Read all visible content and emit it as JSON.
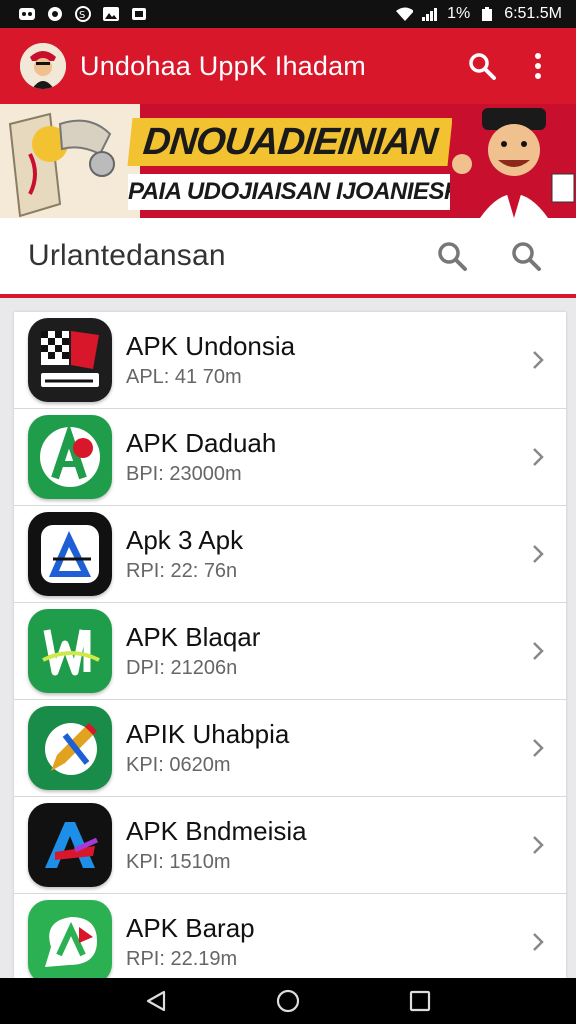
{
  "status_bar": {
    "battery": "1%",
    "time": "6:51.5M"
  },
  "app_bar": {
    "title": "Undohaa UppK Ihadam"
  },
  "banner": {
    "headline": "DNOUADIEINIAN",
    "subline": "PAIA UDOJIAISAN IJOANIESR"
  },
  "search": {
    "label": "Urlantedansan"
  },
  "apps": [
    {
      "name": "APK Undonsia",
      "meta": "APL: 41 70m",
      "icon": "checkered-flag-icon",
      "color": "#1d1d1d"
    },
    {
      "name": "APK Daduah",
      "meta": "BPI: 23000m",
      "icon": "letter-a-icon",
      "color": "#1f9d4a"
    },
    {
      "name": "Apk 3 Apk",
      "meta": "RPI: 22: 76n",
      "icon": "letter-a-outline-icon",
      "color": "#111111"
    },
    {
      "name": "APK Blaqar",
      "meta": "DPI: 21206n",
      "icon": "letter-w-icon",
      "color": "#1f9d4a"
    },
    {
      "name": "APIK Uhabpia",
      "meta": "KPI: 0620m",
      "icon": "pencil-icon",
      "color": "#1a8c4a"
    },
    {
      "name": "APK Bndmeisia",
      "meta": "KPI: 1510m",
      "icon": "letter-a-gradient-icon",
      "color": "#111111"
    },
    {
      "name": "APK Barap",
      "meta": "RPI: 22.19m",
      "icon": "chat-bubble-icon",
      "color": "#2bb152"
    }
  ],
  "colors": {
    "primary": "#d8172b",
    "banner_yellow": "#f2c230"
  }
}
